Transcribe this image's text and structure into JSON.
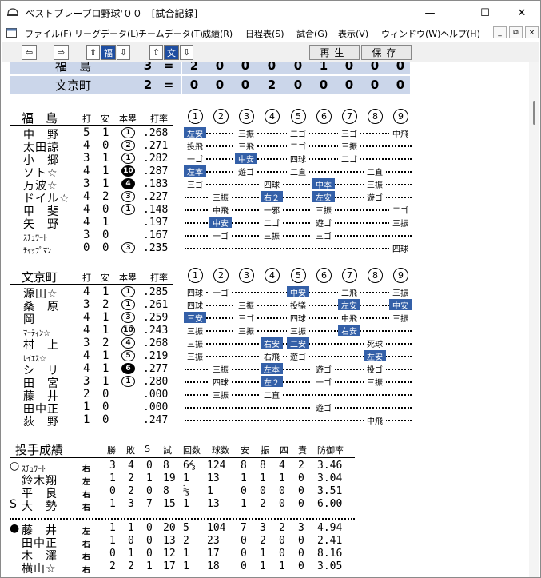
{
  "window": {
    "title": "ベストプレープロ野球'００ - [試合記録]",
    "min_glyph": "—",
    "max_glyph": "☐",
    "close_glyph": "✕"
  },
  "menu": [
    "ファイル(F)",
    "リーグデータ(L)",
    "チームデータ(T)",
    "成績(R)",
    "日程表(S)",
    "試合(G)",
    "表示(V)",
    "ウィンドウ(W)",
    "ヘルプ(H)"
  ],
  "mdi": {
    "min": "_",
    "restore": "⧉",
    "close": "×"
  },
  "toolbar": {
    "prev": "⇦",
    "next": "⇨",
    "up": "⇧",
    "down": "⇩",
    "team1": "福",
    "team2": "文",
    "play": "再生",
    "save": "保存"
  },
  "scoreboard": [
    {
      "team": "福　島",
      "total": "3",
      "eq": "=",
      "innings": [
        "2",
        "0",
        "0",
        "0",
        "0",
        "1",
        "0",
        "0",
        "0"
      ]
    },
    {
      "team": "文京町",
      "total": "2",
      "eq": "=",
      "innings": [
        "0",
        "0",
        "0",
        "2",
        "0",
        "0",
        "0",
        "0",
        "0"
      ]
    }
  ],
  "batting_headers": {
    "at_bats": "打",
    "hits": "安",
    "hr": "本塁",
    "avg": "打率"
  },
  "innings_labels": [
    "1",
    "2",
    "3",
    "4",
    "5",
    "6",
    "7",
    "8",
    "9"
  ],
  "teams": [
    {
      "name": "福　島",
      "batters": [
        {
          "name": "中　野",
          "small": false,
          "ab": "5",
          "h": "1",
          "hr": "1",
          "hr_black": false,
          "avg": ".268",
          "events": [
            {
              "i": 1,
              "t": "左安",
              "hl": true
            },
            {
              "i": 3,
              "t": "三振"
            },
            {
              "i": 5,
              "t": "二ゴ"
            },
            {
              "i": 7,
              "t": "三ゴ"
            },
            {
              "i": 9,
              "t": "中飛"
            }
          ]
        },
        {
          "name": "太田諒",
          "small": false,
          "ab": "4",
          "h": "0",
          "hr": "2",
          "hr_black": false,
          "avg": ".271",
          "events": [
            {
              "i": 1,
              "t": "投飛"
            },
            {
              "i": 3,
              "t": "三飛"
            },
            {
              "i": 5,
              "t": "二ゴ"
            },
            {
              "i": 7,
              "t": "三振"
            }
          ]
        },
        {
          "name": "小　郷",
          "small": false,
          "ab": "3",
          "h": "1",
          "hr": "1",
          "hr_black": false,
          "avg": ".282",
          "events": [
            {
              "i": 1,
              "t": "一ゴ"
            },
            {
              "i": 3,
              "t": "中安",
              "hl": true
            },
            {
              "i": 5,
              "t": "四球"
            },
            {
              "i": 7,
              "t": "二ゴ"
            }
          ]
        },
        {
          "name": "ソト☆",
          "small": false,
          "ab": "4",
          "h": "1",
          "hr": "10",
          "hr_black": true,
          "avg": ".287",
          "events": [
            {
              "i": 1,
              "t": "左本",
              "hl": true
            },
            {
              "i": 3,
              "t": "遊ゴ"
            },
            {
              "i": 5,
              "t": "二直"
            },
            {
              "i": 8,
              "t": "二直"
            }
          ]
        },
        {
          "name": "万波☆",
          "small": false,
          "ab": "3",
          "h": "1",
          "hr": "4",
          "hr_black": true,
          "avg": ".183",
          "events": [
            {
              "i": 1,
              "t": "三ゴ"
            },
            {
              "i": 4,
              "t": "四球"
            },
            {
              "i": 6,
              "t": "中本",
              "hl": true
            },
            {
              "i": 8,
              "t": "三振"
            }
          ]
        },
        {
          "name": "ドイル☆",
          "small": false,
          "ab": "4",
          "h": "2",
          "hr": "3",
          "hr_black": false,
          "avg": ".227",
          "events": [
            {
              "i": 2,
              "t": "三振"
            },
            {
              "i": 4,
              "t": "右２",
              "hl": true
            },
            {
              "i": 6,
              "t": "左安",
              "hl": true
            },
            {
              "i": 8,
              "t": "遊ゴ"
            }
          ]
        },
        {
          "name": "甲　斐",
          "small": false,
          "ab": "4",
          "h": "0",
          "hr": "1",
          "hr_black": false,
          "avg": ".148",
          "events": [
            {
              "i": 2,
              "t": "中飛"
            },
            {
              "i": 4,
              "t": "一邪"
            },
            {
              "i": 6,
              "t": "三振"
            },
            {
              "i": 9,
              "t": "二ゴ"
            }
          ]
        },
        {
          "name": "矢　野",
          "small": false,
          "ab": "4",
          "h": "1",
          "hr": "",
          "hr_black": false,
          "avg": ".197",
          "events": [
            {
              "i": 2,
              "t": "中安",
              "hl": true
            },
            {
              "i": 4,
              "t": "二ゴ"
            },
            {
              "i": 6,
              "t": "遊ゴ"
            },
            {
              "i": 9,
              "t": "三振"
            }
          ]
        },
        {
          "name": "ｽﾁｭﾜｰﾄ",
          "small": true,
          "ab": "3",
          "h": "0",
          "hr": "",
          "hr_black": false,
          "avg": ".167",
          "events": [
            {
              "i": 2,
              "t": "一ゴ"
            },
            {
              "i": 4,
              "t": "三振"
            },
            {
              "i": 6,
              "t": "三ゴ"
            }
          ]
        },
        {
          "name": "ﾁｬｯﾌﾟﾏﾝ",
          "small": true,
          "ab": "0",
          "h": "0",
          "hr": "3",
          "hr_black": false,
          "avg": ".235",
          "events": [
            {
              "i": 9,
              "t": "四球"
            }
          ]
        }
      ]
    },
    {
      "name": "文京町",
      "batters": [
        {
          "name": "源田☆",
          "small": false,
          "ab": "4",
          "h": "1",
          "hr": "1",
          "hr_black": false,
          "avg": ".285",
          "events": [
            {
              "i": 1,
              "t": "四球"
            },
            {
              "i": 2,
              "t": "一ゴ"
            },
            {
              "i": 5,
              "t": "中安",
              "hl": true
            },
            {
              "i": 7,
              "t": "二飛"
            },
            {
              "i": 9,
              "t": "三振"
            }
          ]
        },
        {
          "name": "桑　原",
          "small": false,
          "ab": "3",
          "h": "2",
          "hr": "1",
          "hr_black": false,
          "avg": ".261",
          "events": [
            {
              "i": 1,
              "t": "四球"
            },
            {
              "i": 3,
              "t": "三振"
            },
            {
              "i": 5,
              "t": "投犠"
            },
            {
              "i": 7,
              "t": "左安",
              "hl": true
            },
            {
              "i": 9,
              "t": "中安",
              "hl": true
            }
          ]
        },
        {
          "name": "岡",
          "small": false,
          "ab": "4",
          "h": "1",
          "hr": "3",
          "hr_black": false,
          "avg": ".259",
          "events": [
            {
              "i": 1,
              "t": "三安",
              "hl": true
            },
            {
              "i": 3,
              "t": "三ゴ"
            },
            {
              "i": 5,
              "t": "四球"
            },
            {
              "i": 7,
              "t": "中飛"
            },
            {
              "i": 9,
              "t": "三振"
            }
          ]
        },
        {
          "name": "ﾏｰﾃｨﾝ☆",
          "small": true,
          "ab": "4",
          "h": "1",
          "hr": "10",
          "hr_black": false,
          "avg": ".243",
          "events": [
            {
              "i": 1,
              "t": "三振"
            },
            {
              "i": 3,
              "t": "三振"
            },
            {
              "i": 5,
              "t": "三振"
            },
            {
              "i": 7,
              "t": "右安",
              "hl": true
            }
          ]
        },
        {
          "name": "村　上",
          "small": false,
          "ab": "3",
          "h": "2",
          "hr": "4",
          "hr_black": false,
          "avg": ".268",
          "events": [
            {
              "i": 1,
              "t": "三振"
            },
            {
              "i": 4,
              "t": "右安",
              "hl": true
            },
            {
              "i": 5,
              "t": "二安",
              "hl": true
            },
            {
              "i": 8,
              "t": "死球"
            }
          ]
        },
        {
          "name": "ﾚｲｴｽ☆",
          "small": true,
          "ab": "4",
          "h": "1",
          "hr": "5",
          "hr_black": false,
          "avg": ".219",
          "events": [
            {
              "i": 1,
              "t": "三振"
            },
            {
              "i": 4,
              "t": "右飛"
            },
            {
              "i": 5,
              "t": "遊ゴ"
            },
            {
              "i": 8,
              "t": "左安",
              "hl": true
            }
          ]
        },
        {
          "name": "シ　リ",
          "small": false,
          "ab": "4",
          "h": "1",
          "hr": "6",
          "hr_black": true,
          "avg": ".277",
          "events": [
            {
              "i": 2,
              "t": "三振"
            },
            {
              "i": 4,
              "t": "左本",
              "hl": true
            },
            {
              "i": 6,
              "t": "遊ゴ"
            },
            {
              "i": 8,
              "t": "投ゴ"
            }
          ]
        },
        {
          "name": "田　宮",
          "small": false,
          "ab": "3",
          "h": "1",
          "hr": "1",
          "hr_black": false,
          "avg": ".280",
          "events": [
            {
              "i": 2,
              "t": "四球"
            },
            {
              "i": 4,
              "t": "左２",
              "hl": true
            },
            {
              "i": 6,
              "t": "一ゴ"
            },
            {
              "i": 8,
              "t": "三振"
            }
          ]
        },
        {
          "name": "藤　井",
          "small": false,
          "ab": "2",
          "h": "0",
          "hr": "",
          "hr_black": false,
          "avg": ".000",
          "events": [
            {
              "i": 2,
              "t": "三振"
            },
            {
              "i": 4,
              "t": "二直"
            }
          ]
        },
        {
          "name": "田中正",
          "small": false,
          "ab": "1",
          "h": "0",
          "hr": "",
          "hr_black": false,
          "avg": ".000",
          "events": [
            {
              "i": 6,
              "t": "遊ゴ"
            }
          ]
        },
        {
          "name": "荻　野",
          "small": false,
          "ab": "1",
          "h": "0",
          "hr": "",
          "hr_black": false,
          "avg": ".247",
          "events": [
            {
              "i": 8,
              "t": "中飛"
            }
          ]
        }
      ]
    }
  ],
  "pitching": {
    "title": "投手成績",
    "headers": [
      "勝",
      "敗",
      "S",
      "試",
      "回数",
      "球数",
      "安",
      "振",
      "四",
      "責",
      "防御率"
    ],
    "groups": [
      [
        {
          "mark": "○",
          "name": "ｽﾁｭﾜｰﾄ",
          "small": true,
          "hand": "右",
          "w": "3",
          "l": "4",
          "s": "0",
          "g": "8",
          "ip": "6⅔",
          "np": "124",
          "h": "8",
          "so": "8",
          "bb": "4",
          "er": "2",
          "era": "3.46"
        },
        {
          "mark": "",
          "name": "鈴木翔",
          "small": false,
          "hand": "左",
          "w": "1",
          "l": "2",
          "s": "1",
          "g": "19",
          "ip": "1",
          "np": "13",
          "h": "1",
          "so": "1",
          "bb": "1",
          "er": "0",
          "era": "3.04"
        },
        {
          "mark": "",
          "name": "平　良",
          "small": false,
          "hand": "右",
          "w": "0",
          "l": "2",
          "s": "0",
          "g": "8",
          "ip": "⅓",
          "np": "1",
          "h": "0",
          "so": "0",
          "bb": "0",
          "er": "0",
          "era": "3.51"
        },
        {
          "mark": "S",
          "name": "大　勢",
          "small": false,
          "hand": "右",
          "w": "1",
          "l": "3",
          "s": "7",
          "g": "15",
          "ip": "1",
          "np": "13",
          "h": "1",
          "so": "2",
          "bb": "0",
          "er": "0",
          "era": "6.00"
        }
      ],
      [
        {
          "mark": "●",
          "name": "藤　井",
          "small": false,
          "hand": "左",
          "w": "1",
          "l": "1",
          "s": "0",
          "g": "20",
          "ip": "5",
          "np": "104",
          "h": "7",
          "so": "3",
          "bb": "2",
          "er": "3",
          "era": "4.94"
        },
        {
          "mark": "",
          "name": "田中正",
          "small": false,
          "hand": "右",
          "w": "1",
          "l": "0",
          "s": "0",
          "g": "13",
          "ip": "2",
          "np": "23",
          "h": "0",
          "so": "2",
          "bb": "0",
          "er": "0",
          "era": "2.41"
        },
        {
          "mark": "",
          "name": "木　澤",
          "small": false,
          "hand": "右",
          "w": "0",
          "l": "1",
          "s": "0",
          "g": "12",
          "ip": "1",
          "np": "17",
          "h": "0",
          "so": "1",
          "bb": "0",
          "er": "0",
          "era": "8.16"
        },
        {
          "mark": "",
          "name": "横山☆",
          "small": false,
          "hand": "右",
          "w": "2",
          "l": "2",
          "s": "1",
          "g": "17",
          "ip": "1",
          "np": "18",
          "h": "0",
          "so": "1",
          "bb": "1",
          "er": "0",
          "era": "3.05"
        }
      ]
    ]
  }
}
